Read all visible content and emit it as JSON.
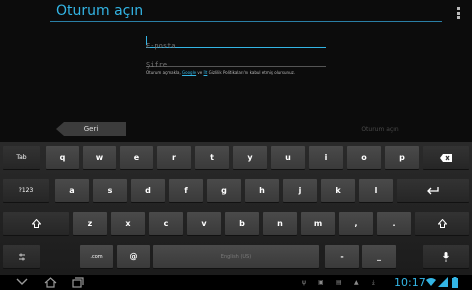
{
  "app": {
    "title": "Oturum açın",
    "email_placeholder": "E-posta",
    "password_placeholder": "Şifre",
    "legal_prefix": "Oturum açmakla, ",
    "legal_google": "Google",
    "legal_mid": " ve ",
    "legal_its": "İlt",
    "legal_suffix": " Gizlilik Politikaları'nı kabul etmiş olursunuz.",
    "back_label": "Geri",
    "signin_label": "Oturum açın"
  },
  "keyboard": {
    "row1": [
      "q",
      "w",
      "e",
      "r",
      "t",
      "y",
      "u",
      "i",
      "o",
      "p"
    ],
    "row2": [
      "a",
      "s",
      "d",
      "f",
      "g",
      "h",
      "j",
      "k",
      "l"
    ],
    "row3": [
      "z",
      "x",
      "c",
      "v",
      "b",
      "n",
      "m",
      ",",
      "."
    ],
    "tab_label": "Tab",
    "numeric_label": "?123",
    "backspace_icon": "backspace-icon",
    "enter_icon": "enter-icon",
    "shift_icon": "shift-icon",
    "settings_icon": "settings-icon",
    "com_label": ".com",
    "at_label": "@",
    "space_label": "English (US)",
    "dash_label": "-",
    "underscore_label": "_",
    "mic_icon": "mic-icon"
  },
  "system_bar": {
    "time": "10:17",
    "icons": [
      "hide-keyboard-icon",
      "home-icon",
      "recent-apps-icon",
      "usb-icon",
      "screenshot-icon",
      "warning-icon",
      "download-icon",
      "wifi-icon",
      "battery-icon"
    ]
  },
  "colors": {
    "accent": "#33b5e5",
    "key": "#444444",
    "keyboard_bg": "#222222"
  }
}
